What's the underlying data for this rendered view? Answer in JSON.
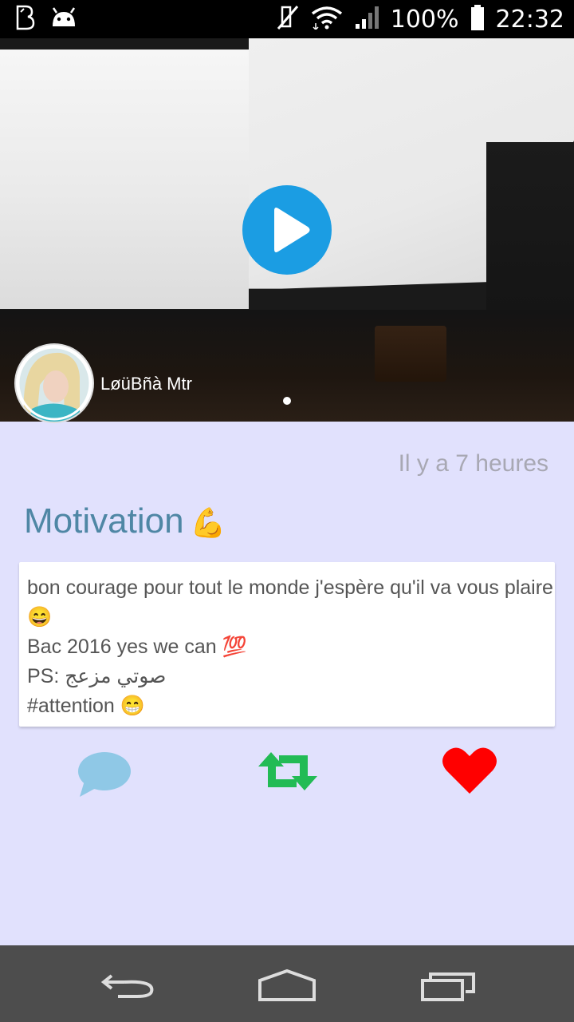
{
  "status_bar": {
    "left_icons": [
      "b-app-icon",
      "android-debug-icon"
    ],
    "right_icons": [
      "mute-icon",
      "wifi-icon",
      "signal-icon",
      "battery-icon"
    ],
    "battery": "100%",
    "time": "22:32"
  },
  "video": {
    "username": "LøüBñà Mtr",
    "play_icon": "play-icon",
    "page_indicator": "1"
  },
  "post": {
    "timestamp": "Il y a 7 heures",
    "title": "Motivation",
    "title_emoji": "💪",
    "lines": [
      "bon courage pour tout le monde j'espère qu'il va vous plaire",
      "😄",
      "Bac 2016 yes we can 💯",
      "PS:  صوتي مزعج",
      "#attention 😁"
    ]
  },
  "actions": {
    "comment_icon": "comment-icon",
    "repost_icon": "repost-icon",
    "like_icon": "heart-icon",
    "colors": {
      "comment": "#8fc8e6",
      "repost": "#22bb55",
      "like": "#ff0000"
    }
  },
  "nav_bar": {
    "back_icon": "back-icon",
    "home_icon": "home-icon",
    "recents_icon": "recents-icon"
  },
  "colors": {
    "background": "#e1e1fd",
    "accent": "#1b9de3",
    "title": "#4f87a5"
  }
}
